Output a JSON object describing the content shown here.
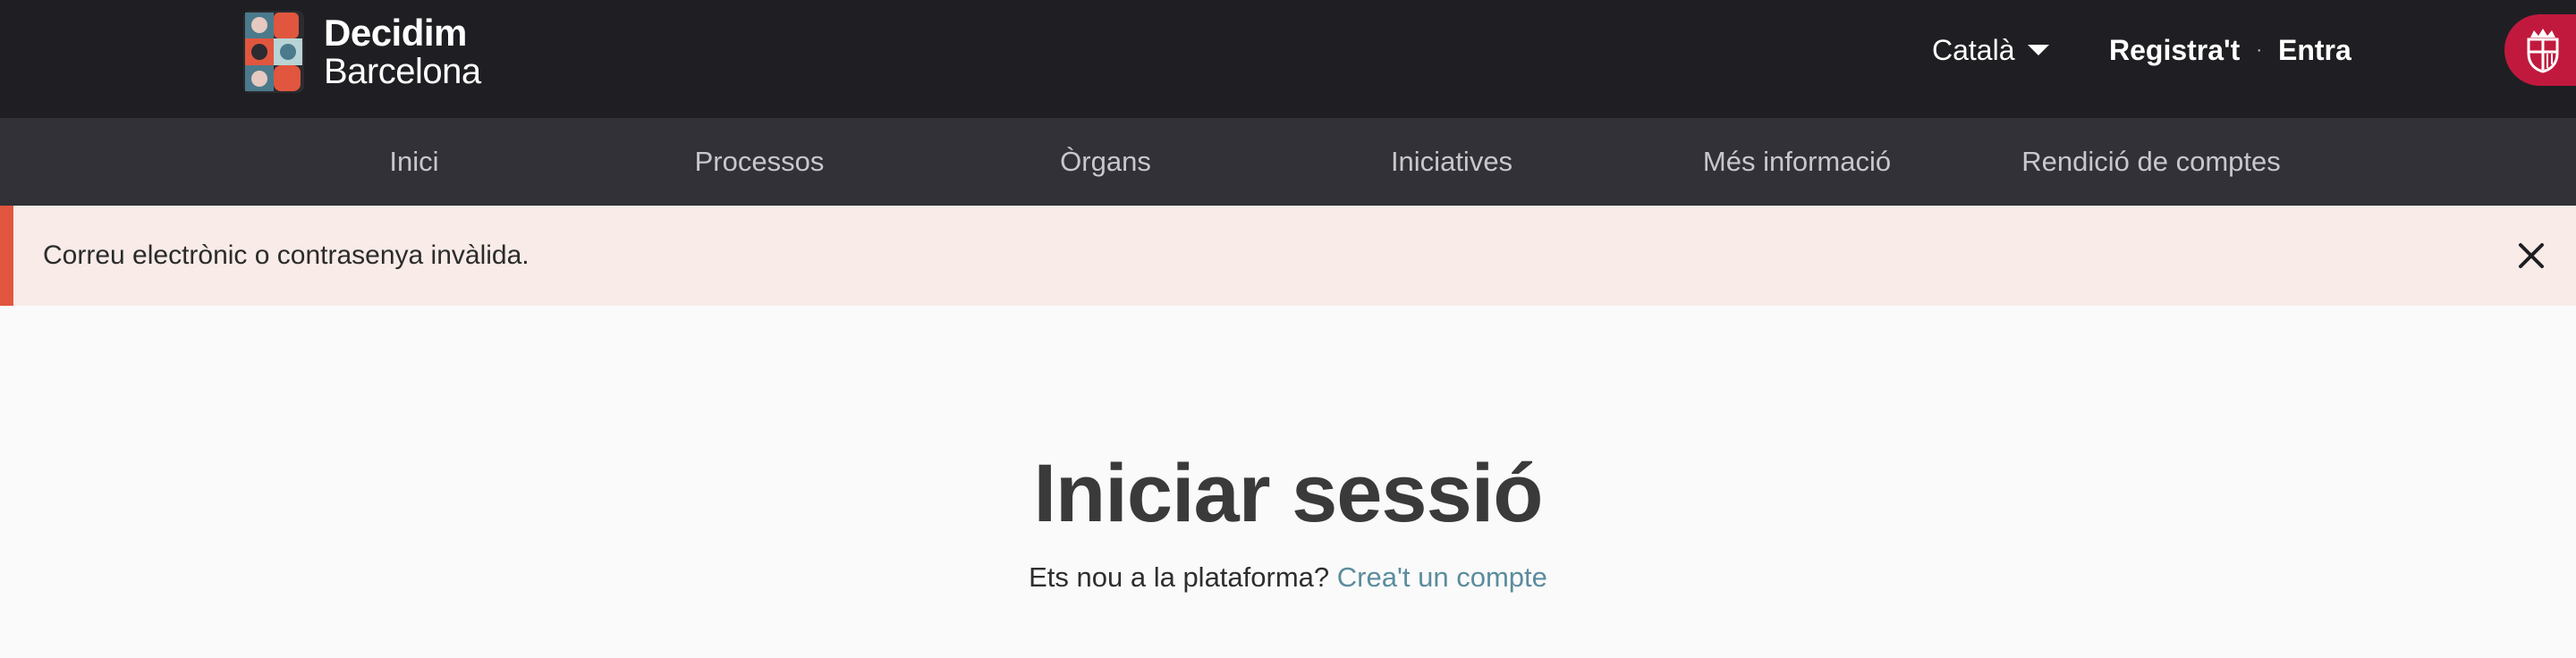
{
  "header": {
    "logo": {
      "line1": "Decidim",
      "line2": "Barcelona"
    },
    "language": "Català",
    "register": "Registra't",
    "separator": "·",
    "login": "Entra"
  },
  "nav": {
    "items": [
      "Inici",
      "Processos",
      "Òrgans",
      "Iniciatives",
      "Més informació",
      "Rendició de comptes"
    ]
  },
  "flash": {
    "message": "Correu electrònic o contrasenya invàlida."
  },
  "main": {
    "title": "Iniciar sessió",
    "prompt": "Ets nou a la plataforma?",
    "signup_link": "Crea't un compte"
  },
  "colors": {
    "topbar": "#1f1f23",
    "navbar": "#323137",
    "flash_bg": "#f8ebe8",
    "flash_accent": "#e1563e",
    "link": "#5b8c9e",
    "city_badge": "#c1193d"
  },
  "icons": {
    "logo": "decidim-b-logo-icon",
    "language_caret": "caret-down-icon",
    "flash_close": "close-icon",
    "city": "barcelona-shield-icon"
  }
}
